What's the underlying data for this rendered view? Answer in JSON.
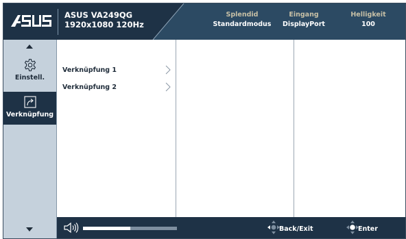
{
  "header": {
    "brand_icon": "asus-logo",
    "model": "ASUS VA249QG",
    "spec": "1920x1080 120Hz",
    "status": [
      {
        "label": "Splendid",
        "value": "Standardmodus"
      },
      {
        "label": "Eingang",
        "value": "DisplayPort"
      },
      {
        "label": "Helligkeit",
        "value": "100"
      }
    ]
  },
  "sidebar": {
    "up_icon": "arrow-up-icon",
    "down_icon": "arrow-down-icon",
    "items": [
      {
        "label": "Einstell.",
        "icon": "gear-icon",
        "active": false
      },
      {
        "label": "Verknüpfung",
        "icon": "shortcut-icon",
        "active": true
      }
    ]
  },
  "menu": {
    "items": [
      {
        "label": "Verknüpfung 1",
        "icon": "chevron-right-icon"
      },
      {
        "label": "Verknüpfung 2",
        "icon": "chevron-right-icon"
      }
    ]
  },
  "footer": {
    "volume_icon": "speaker-icon",
    "volume_level": 0.5,
    "hints": [
      {
        "label": "Back/Exit",
        "icon": "joystick-left-icon"
      },
      {
        "label": "Enter",
        "icon": "joystick-press-icon"
      }
    ]
  },
  "colors": {
    "header_bg": "#1e3246",
    "header_accent": "#2c4a63",
    "sidebar_bg": "#c5d1dc",
    "status_label": "#c7c0a6",
    "text_dark": "#1f2c3a"
  }
}
